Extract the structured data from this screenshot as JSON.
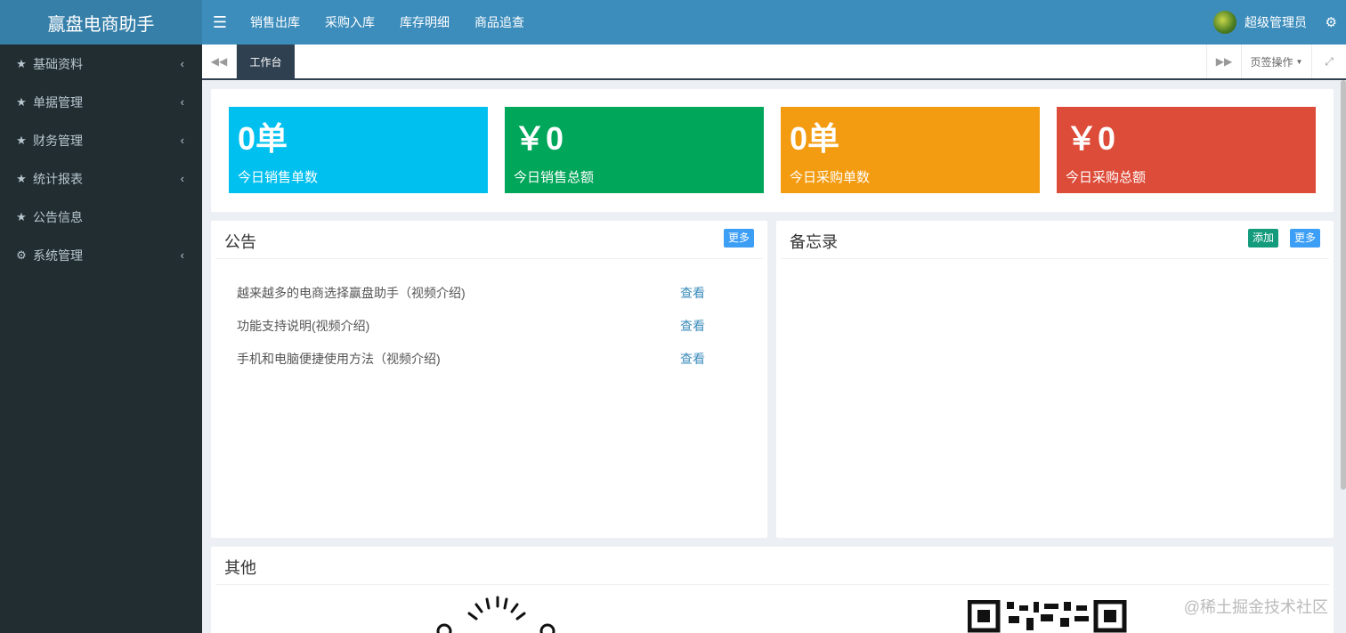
{
  "brand": {
    "title": "赢盘电商助手"
  },
  "sidebar": {
    "items": [
      {
        "label": "基础资料",
        "icon": "star-icon",
        "has_children": true
      },
      {
        "label": "单据管理",
        "icon": "star-icon",
        "has_children": true
      },
      {
        "label": "财务管理",
        "icon": "star-icon",
        "has_children": true
      },
      {
        "label": "统计报表",
        "icon": "star-icon",
        "has_children": true
      },
      {
        "label": "公告信息",
        "icon": "star-icon",
        "has_children": false
      },
      {
        "label": "系统管理",
        "icon": "gear-icon",
        "has_children": true
      }
    ]
  },
  "header": {
    "nav": [
      "销售出库",
      "采购入库",
      "库存明细",
      "商品追查"
    ],
    "user": "超级管理员"
  },
  "tabs": {
    "active": "工作台",
    "ops_label": "页签操作"
  },
  "stats": [
    {
      "value": "0单",
      "label": "今日销售单数",
      "color": "#00c0ef"
    },
    {
      "value": "￥0",
      "label": "今日销售总额",
      "color": "#00a65a"
    },
    {
      "value": "0单",
      "label": "今日采购单数",
      "color": "#f39c12"
    },
    {
      "value": "￥0",
      "label": "今日采购总额",
      "color": "#dd4b39"
    }
  ],
  "notice": {
    "title": "公告",
    "more": "更多",
    "items": [
      {
        "text": "越来越多的电商选择赢盘助手（视频介绍)",
        "action": "查看"
      },
      {
        "text": "功能支持说明(视频介绍)",
        "action": "查看"
      },
      {
        "text": "手机和电脑便捷使用方法（视频介绍)",
        "action": "查看"
      }
    ]
  },
  "memo": {
    "title": "备忘录",
    "add": "添加",
    "more": "更多"
  },
  "other": {
    "title": "其他"
  },
  "watermark": "@稀土掘金技术社区",
  "colors": {
    "brand_bg": "#367fa9",
    "topbar_bg": "#3c8dbc",
    "sidebar_bg": "#222d32",
    "tab_active_bg": "#2f4050",
    "btn_blue": "#3c9ef5",
    "btn_green": "#139b7c"
  }
}
